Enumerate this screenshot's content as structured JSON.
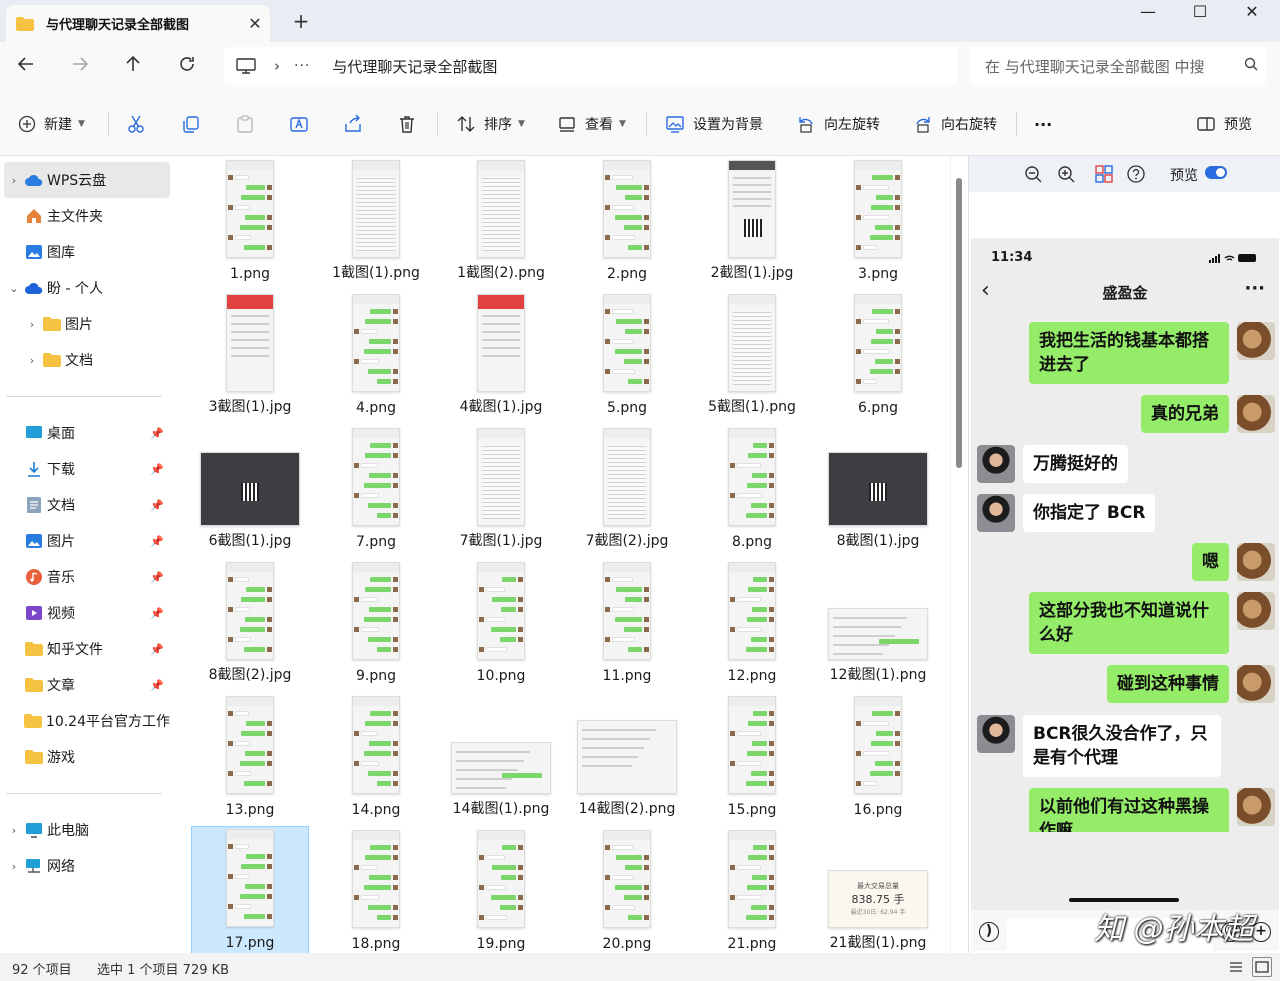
{
  "window": {
    "tab_title": "与代理聊天记录全部截图",
    "close_tab": "✕",
    "new_tab": "+",
    "minimize": "—",
    "maximize": "☐",
    "close": "✕"
  },
  "address": {
    "separator": "›",
    "ellipsis": "···",
    "path": "与代理聊天记录全部截图",
    "search_placeholder": "在 与代理聊天记录全部截图 中搜"
  },
  "toolbar": {
    "new_label": "新建",
    "sort_label": "排序",
    "view_label": "查看",
    "set_bg_label": "设置为背景",
    "rotate_left_label": "向左旋转",
    "rotate_right_label": "向右旋转",
    "more_label": "···",
    "preview_label": "预览"
  },
  "sidebar": {
    "items": [
      {
        "label": "WPS云盘",
        "icon": "cloud-icon"
      },
      {
        "label": "主文件夹",
        "icon": "home-icon"
      },
      {
        "label": "图库",
        "icon": "gallery-icon"
      },
      {
        "label": "盼 - 个人",
        "icon": "onedrive-icon"
      },
      {
        "label": "图片",
        "icon": "folder-icon"
      },
      {
        "label": "文档",
        "icon": "folder-icon"
      },
      {
        "label": "桌面",
        "icon": "desktop-icon"
      },
      {
        "label": "下载",
        "icon": "download-icon"
      },
      {
        "label": "文档",
        "icon": "document-icon"
      },
      {
        "label": "图片",
        "icon": "pictures-icon"
      },
      {
        "label": "音乐",
        "icon": "music-icon"
      },
      {
        "label": "视频",
        "icon": "video-icon"
      },
      {
        "label": "知乎文件",
        "icon": "folder-icon"
      },
      {
        "label": "文章",
        "icon": "folder-icon"
      },
      {
        "label": "10.24平台官方工作",
        "icon": "folder-icon"
      },
      {
        "label": "游戏",
        "icon": "folder-icon"
      },
      {
        "label": "此电脑",
        "icon": "pc-icon"
      },
      {
        "label": "网络",
        "icon": "network-icon"
      }
    ]
  },
  "files": [
    "1.png",
    "1截图(1).png",
    "1截图(2).png",
    "2.png",
    "2截图(1).jpg",
    "3.png",
    "3截图(1).jpg",
    "4.png",
    "4截图(1).jpg",
    "5.png",
    "5截图(1).png",
    "6.png",
    "6截图(1).jpg",
    "7.png",
    "7截图(1).jpg",
    "7截图(2).jpg",
    "8.png",
    "8截图(1).jpg",
    "8截图(2).jpg",
    "9.png",
    "10.png",
    "11.png",
    "12.png",
    "12截图(1).png",
    "13.png",
    "14.png",
    "14截图(1).png",
    "14截图(2).png",
    "15.png",
    "16.png",
    "17.png",
    "18.png",
    "19.png",
    "20.png",
    "21.png",
    "21截图(1).png"
  ],
  "selected_file": "17.png",
  "preview": {
    "preview_toggle_label": "预览",
    "phone_time": "11:34",
    "chat_title": "盛盈金",
    "messages": [
      {
        "side": "right",
        "text": "我把生活的钱基本都搭进去了"
      },
      {
        "side": "right",
        "text": "真的兄弟"
      },
      {
        "side": "left",
        "text": "万腾挺好的"
      },
      {
        "side": "left",
        "text": "你指定了 BCR"
      },
      {
        "side": "right",
        "text": "嗯"
      },
      {
        "side": "right",
        "text": "这部分我也不知道说什么好"
      },
      {
        "side": "right",
        "text": "碰到这种事情"
      },
      {
        "side": "left",
        "text": "BCR很久没合作了，只是有个代理"
      },
      {
        "side": "right",
        "text": "以前他们有过这种黑操作嘛"
      }
    ],
    "thumb_21_line1": "最大交易总量",
    "thumb_21_value": "838.75 手",
    "thumb_21_line2": "最近30日: 62.94 手"
  },
  "watermark": "知 @孙本超",
  "status": {
    "count": "92 个项目",
    "selection": "选中 1 个项目  729 KB"
  },
  "colors": {
    "accent": "#0067c0",
    "chat_green": "#95ec69",
    "selection": "#cce8ff"
  }
}
